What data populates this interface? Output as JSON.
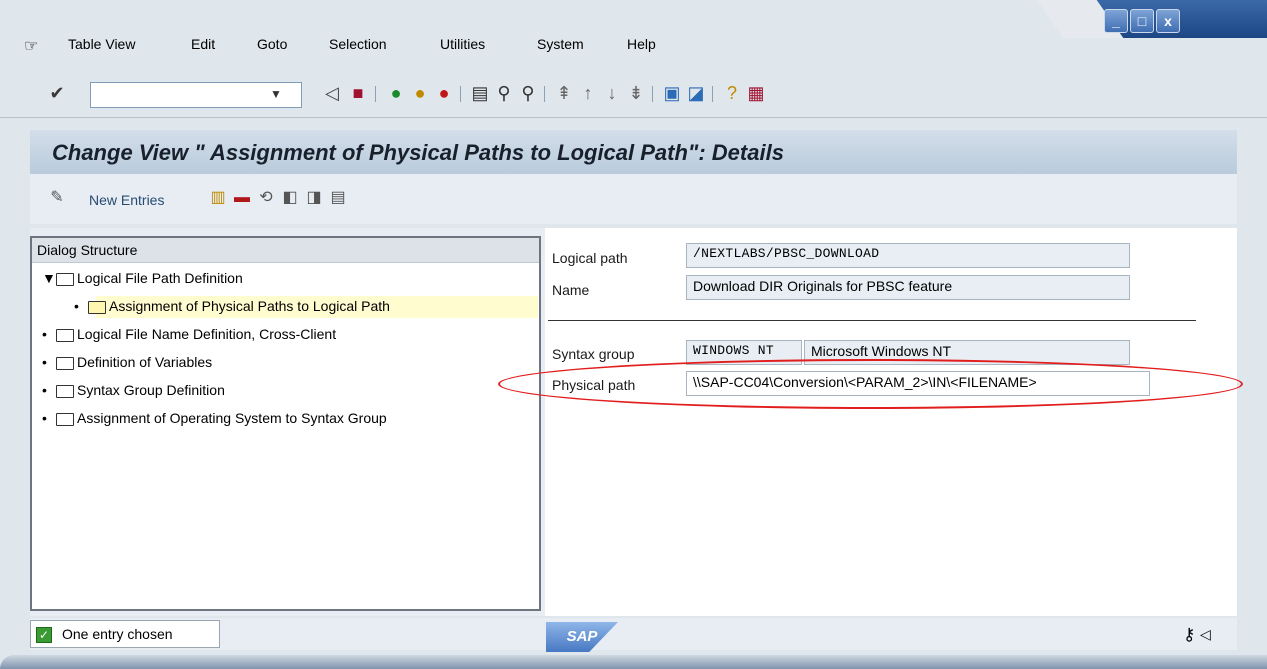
{
  "menubar": {
    "items": [
      "Table View",
      "Edit",
      "Goto",
      "Selection",
      "Utilities",
      "System",
      "Help"
    ]
  },
  "window_controls": {
    "minimize": "_",
    "maximize": "□",
    "close": "x"
  },
  "page_title": "Change View \" Assignment of Physical Paths to Logical Path\": Details",
  "app_toolbar": {
    "new_entries_label": "New Entries"
  },
  "dialog_structure": {
    "header": "Dialog Structure",
    "items": [
      {
        "label": "Logical File Path Definition"
      },
      {
        "label": "Assignment of Physical Paths to Logical Path"
      },
      {
        "label": "Logical File Name Definition, Cross-Client"
      },
      {
        "label": "Definition of Variables"
      },
      {
        "label": "Syntax Group Definition"
      },
      {
        "label": "Assignment of Operating System to Syntax Group"
      }
    ]
  },
  "details": {
    "logical_path_label": "Logical path",
    "logical_path_value": "/NEXTLABS/PBSC_DOWNLOAD",
    "name_label": "Name",
    "name_value": "Download DIR Originals for PBSC feature",
    "syntax_group_label": "Syntax group",
    "syntax_group_value": "WINDOWS NT",
    "syntax_group_desc": "Microsoft Windows NT",
    "physical_path_label": "Physical path",
    "physical_path_value": "\\\\SAP-CC04\\Conversion\\<PARAM_2>\\IN\\<FILENAME>"
  },
  "status": {
    "text": "One entry chosen",
    "logo": "SAP"
  },
  "colors": {
    "highlight_ellipse": "#e11d1d",
    "tree_selection": "#fffcd0",
    "title_bar": "#c6d5e4"
  }
}
